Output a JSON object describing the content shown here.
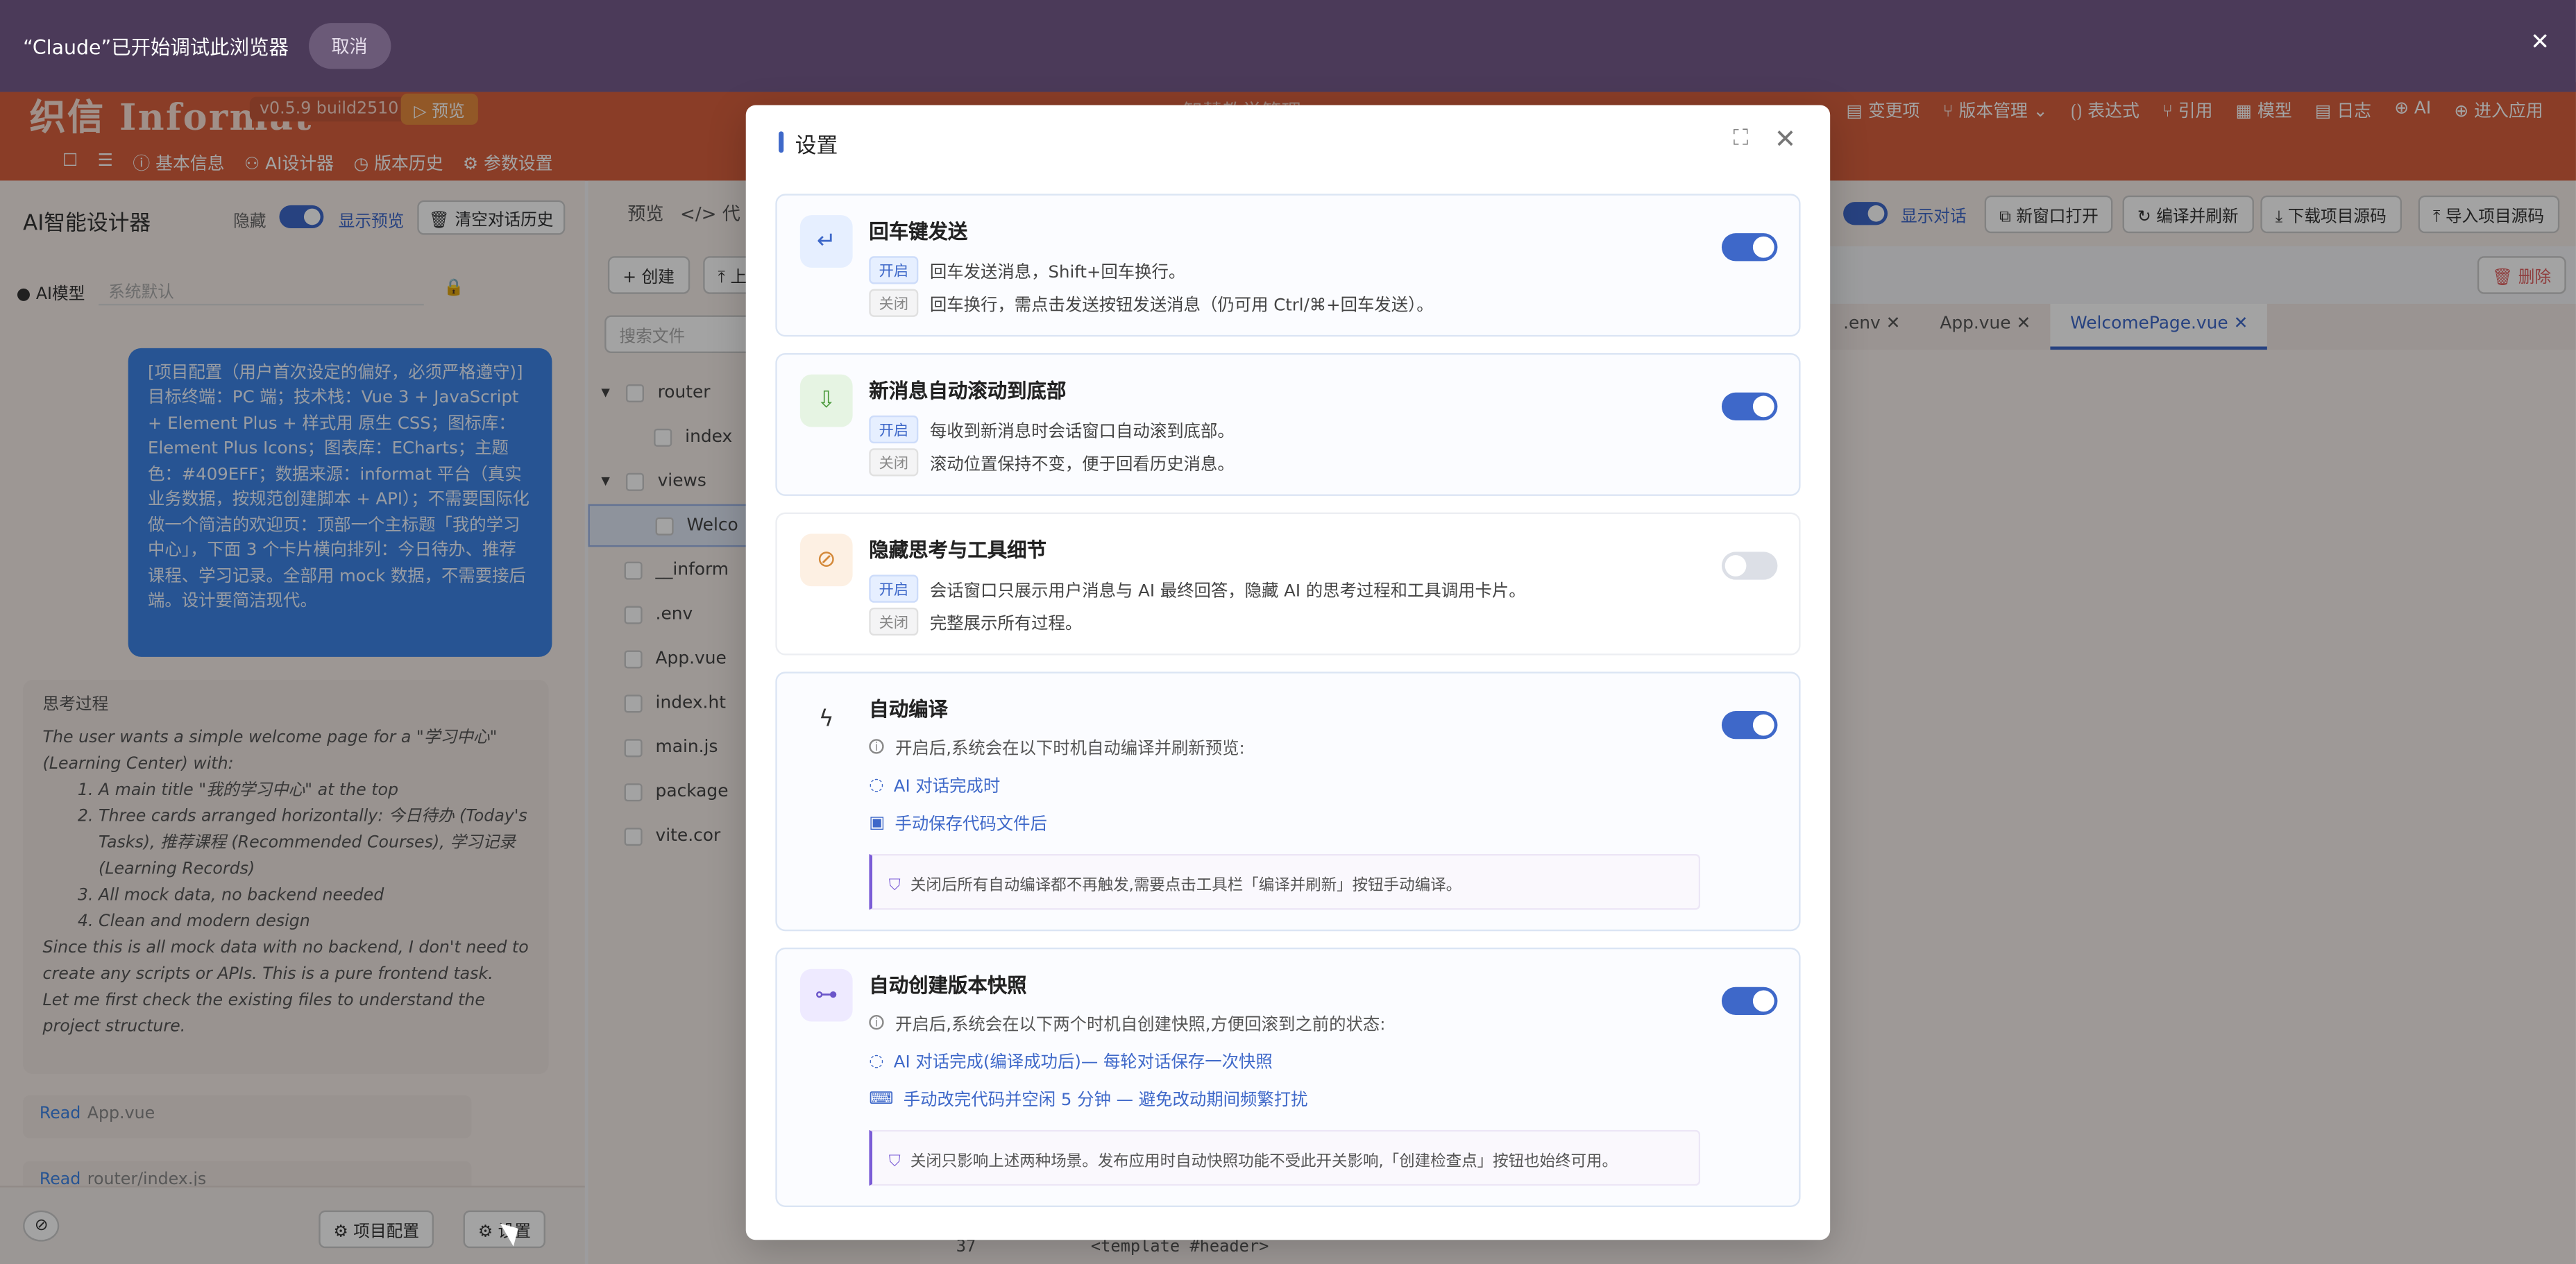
{
  "claude_bar": {
    "message": "“Claude”已开始调试此浏览器",
    "cancel": "取消",
    "close": "✕"
  },
  "app": {
    "logo": "织信 Informat",
    "version": "v0.5.9 build2510",
    "preview_badge": "▷ 预览",
    "title": "智慧教学管理",
    "menu": [
      "▤ 变更项",
      "⑂ 版本管理 ⌄",
      "⟮⟯ 表达式",
      "⑂ 引用",
      "▦ 模型",
      "▤ 日志",
      "⊕ AI",
      "⊕ 进入应用"
    ],
    "tabs": [
      "☐",
      "☰",
      "ⓘ 基本信息",
      "⚇ AI设计器",
      "◷ 版本历史",
      "⚙ 参数设置"
    ]
  },
  "left": {
    "title": "AI智能设计器",
    "hide": "隐藏",
    "show_preview": "显示预览",
    "clear": "🗑 清空对话历史",
    "model_label": "● AI模型",
    "model_value": "系统默认",
    "user_message": "[项目配置（用户首次设定的偏好，必须严格遵守)] 目标终端：PC 端；技术栈：Vue 3 + JavaScript + Element Plus + 样式用 原生 CSS；图标库：Element Plus Icons；图表库：ECharts；主题色：#409EFF；数据来源：informat 平台（真实业务数据，按规范创建脚本 + API）；不需要国际化 做一个简洁的欢迎页：顶部一个主标题「我的学习中心」，下面 3 个卡片横向排列：今日待办、推荐课程、学习记录。全部用 mock 数据，不需要接后端。设计要简洁现代。",
    "think_title": "思考过程",
    "think_p1": "The user wants a simple welcome page for a \"学习中心\" (Learning Center) with:",
    "think_list": [
      "A main title \"我的学习中心\" at the top",
      "Three cards arranged horizontally: 今日待办 (Today's Tasks), 推荐课程 (Recommended Courses), 学习记录 (Learning Records)",
      "All mock data, no backend needed",
      "Clean and modern design"
    ],
    "think_p2": "Since this is all mock data with no backend, I don't need to create any scripts or APIs. This is a pure frontend task.",
    "think_p3": "Let me first check the existing files to understand the project structure.",
    "read1_verb": "Read",
    "read1_file": "App.vue",
    "read2_verb": "Read",
    "read2_file": "router/index.js",
    "project_config": "⚙ 项目配置",
    "settings": "⚙ 设置"
  },
  "mid": {
    "preview_tab": "预览",
    "code_tab": "</> 代",
    "create": "+ 创建",
    "upload": "⤒ 上",
    "search_placeholder": "搜索文件",
    "files": [
      "router",
      "index",
      "views",
      "Welco",
      "__inform",
      ".env",
      "App.vue",
      "index.ht",
      "main.js",
      "package",
      "vite.cor"
    ]
  },
  "editor": {
    "show_chat": "显示对话",
    "new_window": "⧉ 新窗口打开",
    "compile": "↻ 编译并刷新",
    "download": "⤓ 下载项目源码",
    "import": "⤒ 导入项目源码",
    "delete": "🗑 删除",
    "tabs": [
      ".env ✕",
      "App.vue ✕",
      "WelcomePage.vue ✕"
    ],
    "line_num": "37",
    "code_line": "<template #header>"
  },
  "dialog": {
    "title": "设置",
    "cards": [
      {
        "title": "回车键发送",
        "icon": "↵",
        "on_tag": "开启",
        "on_text": "回车发送消息，Shift+回车换行。",
        "off_tag": "关闭",
        "off_text": "回车换行，需点击发送按钮发送消息（仍可用 Ctrl/⌘+回车发送）。",
        "enabled": true
      },
      {
        "title": "新消息自动滚动到底部",
        "icon": "⇩",
        "on_tag": "开启",
        "on_text": "每收到新消息时会话窗口自动滚到底部。",
        "off_tag": "关闭",
        "off_text": "滚动位置保持不变，便于回看历史消息。",
        "enabled": true
      },
      {
        "title": "隐藏思考与工具细节",
        "icon": "⊘",
        "on_tag": "开启",
        "on_text": "会话窗口只展示用户消息与 AI 最终回答，隐藏 AI 的思考过程和工具调用卡片。",
        "off_tag": "关闭",
        "off_text": "完整展示所有过程。",
        "enabled": false
      },
      {
        "title": "自动编译",
        "icon": "ϟ",
        "desc": "开启后,系统会在以下时机自动编译并刷新预览:",
        "link1": "AI 对话完成时",
        "link2": "手动保存代码文件后",
        "note": "关闭后所有自动编译都不再触发,需要点击工具栏「编译并刷新」按钮手动编译。",
        "enabled": true
      },
      {
        "title": "自动创建版本快照",
        "icon": "⊶",
        "desc": "开启后,系统会在以下两个时机自创建快照,方便回滚到之前的状态:",
        "link1": "AI 对话完成(编译成功后)— 每轮对话保存一次快照",
        "link2": "手动改完代码并空闲 5 分钟 — 避免改动期间频繁打扰",
        "note": "关闭只影响上述两种场景。发布应用时自动快照功能不受此开关影响,「创建检查点」按钮也始终可用。",
        "enabled": true
      }
    ]
  }
}
